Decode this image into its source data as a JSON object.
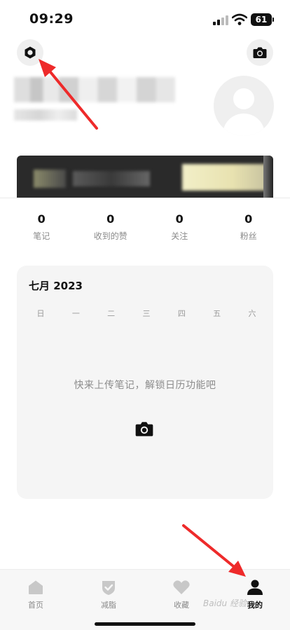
{
  "status_bar": {
    "time": "09:29",
    "battery": "61"
  },
  "stats": [
    {
      "value": "0",
      "label": "笔记"
    },
    {
      "value": "0",
      "label": "收到的赞"
    },
    {
      "value": "0",
      "label": "关注"
    },
    {
      "value": "0",
      "label": "粉丝"
    }
  ],
  "calendar": {
    "title": "七月 2023",
    "weekdays": [
      "日",
      "一",
      "二",
      "三",
      "四",
      "五",
      "六"
    ],
    "empty_tip": "快来上传笔记，解锁日历功能吧"
  },
  "tabbar": {
    "items": [
      {
        "label": "首页",
        "icon": "home-icon",
        "active": false
      },
      {
        "label": "减脂",
        "icon": "shield-check-icon",
        "active": false
      },
      {
        "label": "收藏",
        "icon": "heart-icon",
        "active": false
      },
      {
        "label": "我的",
        "icon": "user-icon",
        "active": true
      }
    ]
  },
  "colors": {
    "annotation_arrow": "#ee2a2a",
    "card_bg": "#f5f5f5",
    "tab_active": "#111111",
    "tab_inactive": "#c8c8c8"
  },
  "watermark": "Baidu 经验"
}
